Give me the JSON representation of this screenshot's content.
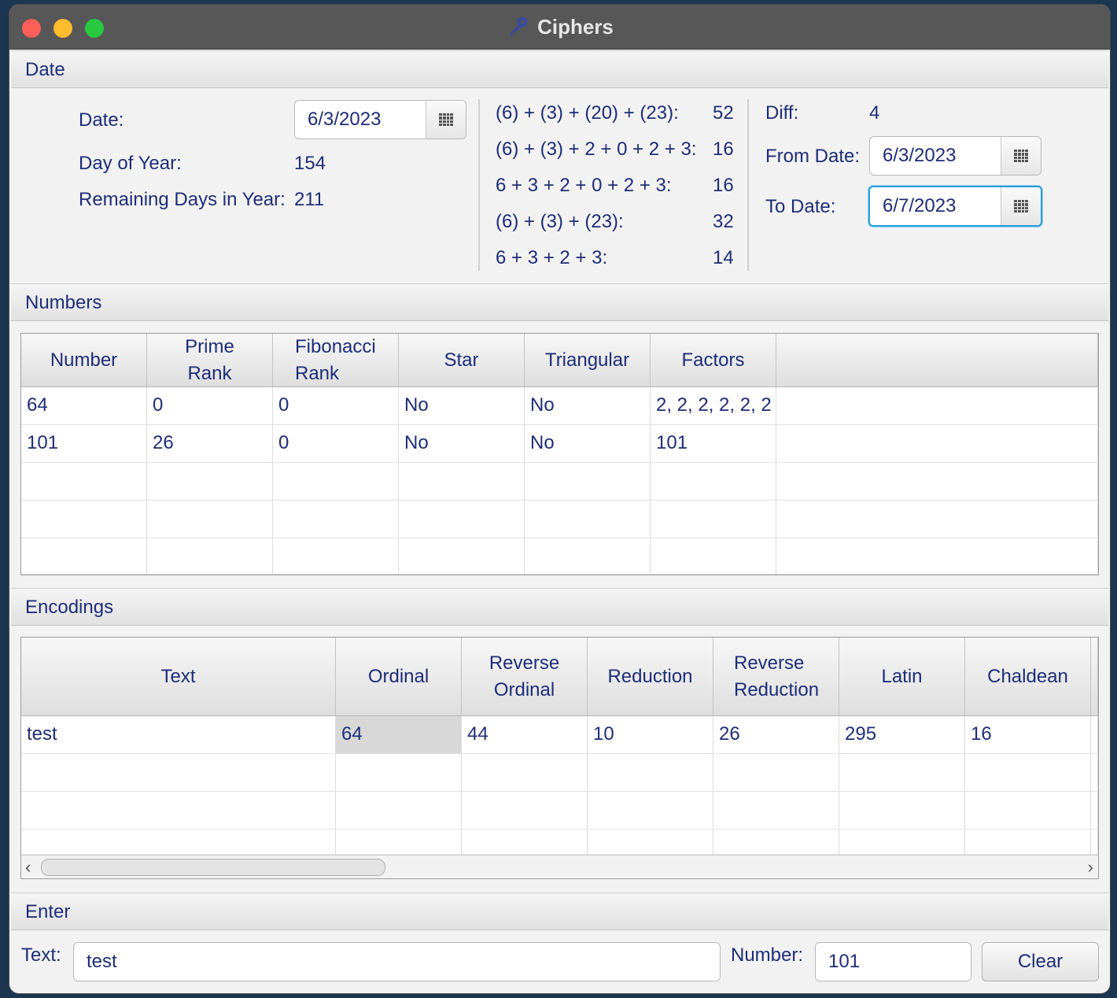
{
  "window": {
    "title": "Ciphers"
  },
  "date_section": {
    "header": "Date",
    "date_label": "Date:",
    "date_value": "6/3/2023",
    "day_of_year_label": "Day of Year:",
    "day_of_year_value": "154",
    "remaining_label": "Remaining Days in Year:",
    "remaining_value": "211",
    "sums": [
      {
        "expr": "(6) + (3) + (20) + (23):",
        "value": "52"
      },
      {
        "expr": "(6) + (3) + 2 + 0 + 2 + 3:",
        "value": "16"
      },
      {
        "expr": "6 + 3 + 2 + 0 + 2 + 3:",
        "value": "16"
      },
      {
        "expr": "(6) + (3) + (23):",
        "value": "32"
      },
      {
        "expr": "6 + 3 + 2 + 3:",
        "value": "14"
      }
    ],
    "diff_label": "Diff:",
    "diff_value": "4",
    "from_label": "From Date:",
    "from_value": "6/3/2023",
    "to_label": "To Date:",
    "to_value": "6/7/2023"
  },
  "numbers_section": {
    "header": "Numbers",
    "columns": [
      "Number",
      "Prime\nRank",
      "Fibonacci\nRank",
      "Star",
      "Triangular",
      "Factors"
    ],
    "rows": [
      [
        "64",
        "0",
        "0",
        "No",
        "No",
        "2, 2, 2, 2, 2, 2"
      ],
      [
        "101",
        "26",
        "0",
        "No",
        "No",
        "101"
      ]
    ]
  },
  "encodings_section": {
    "header": "Encodings",
    "columns": [
      "Text",
      "Ordinal",
      "Reverse\nOrdinal",
      "Reduction",
      "Reverse\nReduction",
      "Latin",
      "Chaldean"
    ],
    "rows": [
      [
        "test",
        "64",
        "44",
        "10",
        "26",
        "295",
        "16"
      ]
    ]
  },
  "enter_section": {
    "header": "Enter",
    "text_label": "Text:",
    "text_value": "test",
    "number_label": "Number:",
    "number_value": "101",
    "clear_label": "Clear"
  }
}
